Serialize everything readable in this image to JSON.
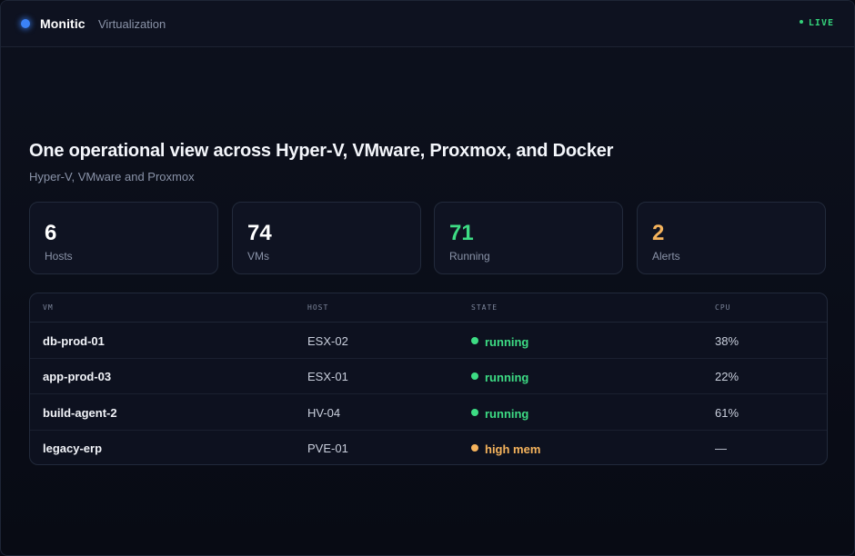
{
  "app": {
    "brand": "Monitic",
    "section": "Virtualization",
    "status": "LIVE"
  },
  "hero": {
    "title": "One operational view across Hyper-V, VMware, Proxmox, and Docker",
    "subtitle": "Hyper-V, VMware and Proxmox"
  },
  "stats": [
    {
      "value": "6",
      "label": "Hosts"
    },
    {
      "value": "74",
      "label": "VMs"
    },
    {
      "value": "71",
      "label": "Running"
    },
    {
      "value": "2",
      "label": "Alerts"
    }
  ],
  "table": {
    "headers": [
      "VM",
      "HOST",
      "STATE",
      "CPU"
    ],
    "rows": [
      {
        "vm": "db-prod-01",
        "host": "ESX-02",
        "state": "running",
        "cpu": "38%"
      },
      {
        "vm": "app-prod-03",
        "host": "ESX-01",
        "state": "running",
        "cpu": "22%"
      },
      {
        "vm": "build-agent-2",
        "host": "HV-04",
        "state": "running",
        "cpu": "61%"
      },
      {
        "vm": "legacy-erp",
        "host": "PVE-01",
        "state": "high mem",
        "cpu": "—"
      }
    ]
  },
  "colors": {
    "accent": "#3b82f6",
    "ok": "#3ddc84",
    "warn": "#f5b35c",
    "background": "#0a0d18"
  },
  "icons": {
    "brand": "brand-dot-icon",
    "live": "live-dot-icon",
    "state_ok": "status-dot-icon",
    "state_warn": "status-dot-icon"
  }
}
